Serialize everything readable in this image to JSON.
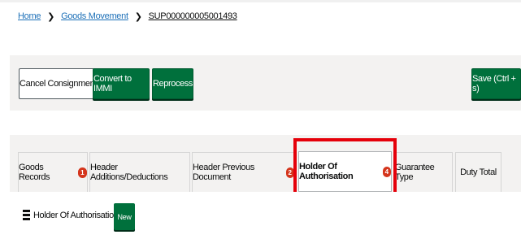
{
  "breadcrumb": {
    "home": "Home",
    "goods_movement": "Goods Movement",
    "current": "SUP000000005001493",
    "separator": "❯"
  },
  "actions": {
    "cancel_consignment": "Cancel Consignment",
    "convert_to_immi": "Convert to IMMI",
    "reprocess": "Reprocess",
    "save": "Save (Ctrl + s)"
  },
  "tabs": [
    {
      "label": "Goods Records",
      "badge": "1"
    },
    {
      "label": "Header Additions/Deductions",
      "badge": ""
    },
    {
      "label": "Header Previous Document",
      "badge": "2"
    },
    {
      "label": "Holder Of Authorisation",
      "badge": "4",
      "active": true
    },
    {
      "label": "Guarantee Type",
      "badge": ""
    },
    {
      "label": "Duty Total",
      "badge": ""
    }
  ],
  "panel": {
    "title": "Holder Of Authorisation",
    "new_button": "New"
  },
  "colors": {
    "primary_green": "#00703c",
    "badge_red": "#d4351c",
    "highlight_red": "#e5000a",
    "link_blue": "#1d70b8"
  }
}
